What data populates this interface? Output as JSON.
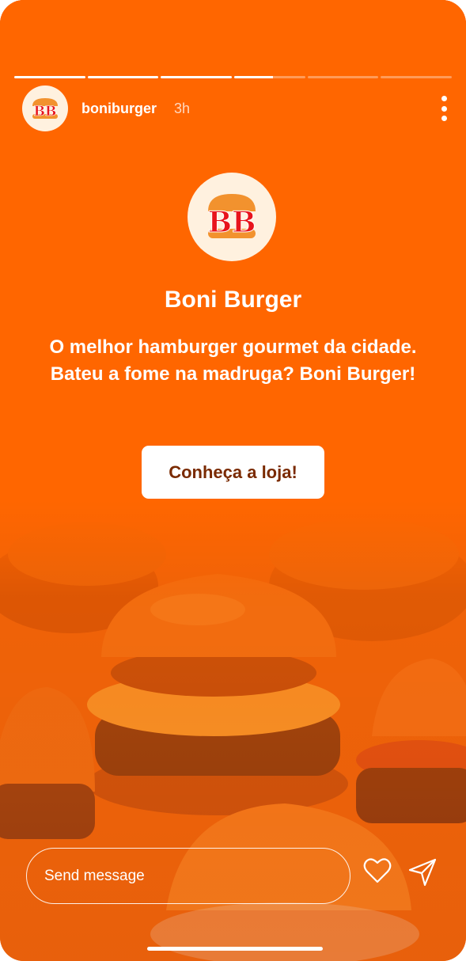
{
  "story": {
    "segments": [
      1,
      1,
      1,
      0.55,
      0,
      0
    ]
  },
  "header": {
    "avatar_text": "BB",
    "username": "boniburger",
    "time": "3h"
  },
  "content": {
    "logo_text": "BB",
    "title": "Boni Burger",
    "tagline": "O melhor hamburger gourmet da cidade. Bateu a fome na madruga? Boni Burger!",
    "cta_label": "Conheça a loja!"
  },
  "footer": {
    "message_placeholder": "Send message"
  },
  "colors": {
    "background": "#FF6600",
    "cta_text": "#7A2A00",
    "logo_red": "#E8141C",
    "logo_bun": "#F2922E"
  },
  "icons": {
    "more": "more-vertical-icon",
    "like": "heart-icon",
    "share": "send-icon"
  }
}
